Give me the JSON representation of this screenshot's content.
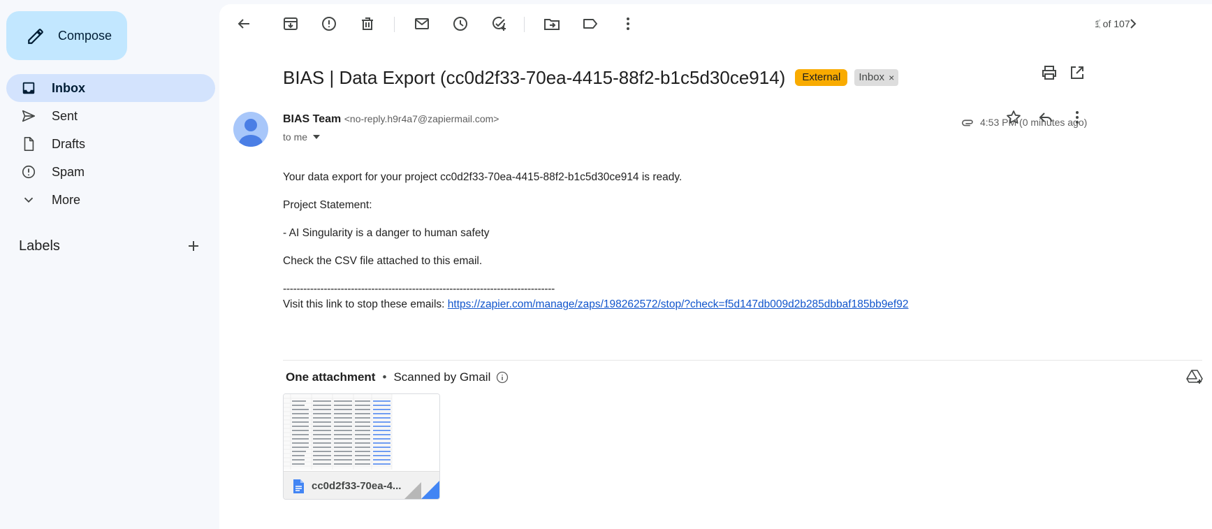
{
  "sidebar": {
    "compose_label": "Compose",
    "items": [
      {
        "label": "Inbox",
        "icon": "inbox-icon",
        "active": true
      },
      {
        "label": "Sent",
        "icon": "send-icon"
      },
      {
        "label": "Drafts",
        "icon": "draft-icon"
      },
      {
        "label": "Spam",
        "icon": "spam-icon"
      },
      {
        "label": "More",
        "icon": "chevron-down-icon"
      }
    ],
    "labels_heading": "Labels"
  },
  "toolbar": {
    "pager": "1 of 107"
  },
  "message": {
    "subject": "BIAS | Data Export (cc0d2f33-70ea-4415-88f2-b1c5d30ce914)",
    "badge_external": "External",
    "badge_inbox": "Inbox",
    "badge_inbox_close": "×",
    "sender_name": "BIAS Team",
    "sender_email": "<no-reply.h9r4a7@zapiermail.com>",
    "to": "to me",
    "time": "4:53 PM (0 minutes ago)",
    "body": {
      "line1": "Your data export for your project cc0d2f33-70ea-4415-88f2-b1c5d30ce914 is ready.",
      "line2": "Project Statement:",
      "line3": "- AI Singularity is a danger to human safety",
      "line4": "Check the CSV file attached to this email.",
      "separator": "--------------------------------------------------------------------------------",
      "stop_prefix": "Visit this link to stop these emails: ",
      "stop_link": "https://zapier.com/manage/zaps/198262572/stop/?check=f5d147db009d2b285dbbaf185bb9ef92"
    }
  },
  "attachments": {
    "heading": "One attachment",
    "dot": "•",
    "scanned": "Scanned by Gmail",
    "file_name": "cc0d2f33-70ea-4..."
  },
  "colors": {
    "compose_bg": "#c2e7ff",
    "active_nav": "#d3e3fd",
    "external_badge": "#f9ab00",
    "link": "#1155cc"
  }
}
